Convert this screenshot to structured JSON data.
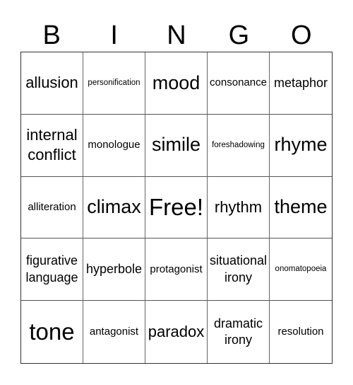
{
  "header": [
    "B",
    "I",
    "N",
    "G",
    "O"
  ],
  "cells": [
    {
      "text": "allusion",
      "size": "s-lg"
    },
    {
      "text": "personification",
      "size": "s-xs"
    },
    {
      "text": "mood",
      "size": "s-xl"
    },
    {
      "text": "consonance",
      "size": "s-sm"
    },
    {
      "text": "metaphor",
      "size": "s-md"
    },
    {
      "text": "internal conflict",
      "size": "s-lg"
    },
    {
      "text": "monologue",
      "size": "s-sm"
    },
    {
      "text": "simile",
      "size": "s-xl"
    },
    {
      "text": "foreshadowing",
      "size": "s-xs"
    },
    {
      "text": "rhyme",
      "size": "s-xl"
    },
    {
      "text": "alliteration",
      "size": "s-sm"
    },
    {
      "text": "climax",
      "size": "s-xl"
    },
    {
      "text": "Free!",
      "size": "s-xxl"
    },
    {
      "text": "rhythm",
      "size": "s-lg"
    },
    {
      "text": "theme",
      "size": "s-xl"
    },
    {
      "text": "figurative language",
      "size": "s-md"
    },
    {
      "text": "hyperbole",
      "size": "s-md"
    },
    {
      "text": "protagonist",
      "size": "s-sm"
    },
    {
      "text": "situational irony",
      "size": "s-md"
    },
    {
      "text": "onomatopoeia",
      "size": "s-xs"
    },
    {
      "text": "tone",
      "size": "s-xxl"
    },
    {
      "text": "antagonist",
      "size": "s-sm"
    },
    {
      "text": "paradox",
      "size": "s-lg"
    },
    {
      "text": "dramatic irony",
      "size": "s-md"
    },
    {
      "text": "resolution",
      "size": "s-sm"
    }
  ]
}
